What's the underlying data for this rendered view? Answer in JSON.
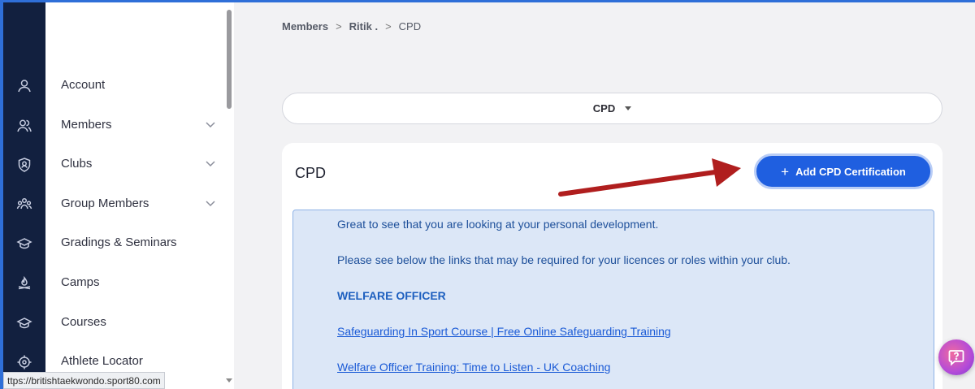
{
  "browser": {
    "status_url": "ttps://britishtaekwondo.sport80.com"
  },
  "rail_icons": [
    {
      "icon": "person-icon"
    },
    {
      "icon": "members-icon"
    },
    {
      "icon": "shield-icon"
    },
    {
      "icon": "group-icon"
    },
    {
      "icon": "graduation-cap-icon"
    },
    {
      "icon": "campfire-icon"
    },
    {
      "icon": "graduation-cap-icon"
    },
    {
      "icon": "locator-icon"
    }
  ],
  "sidebar": {
    "items": [
      {
        "label": "Account",
        "expandable": false
      },
      {
        "label": "Members",
        "expandable": true
      },
      {
        "label": "Clubs",
        "expandable": true
      },
      {
        "label": "Group Members",
        "expandable": true
      },
      {
        "label": "Gradings & Seminars",
        "expandable": false
      },
      {
        "label": "Camps",
        "expandable": false
      },
      {
        "label": "Courses",
        "expandable": false
      },
      {
        "label": "Athlete Locator",
        "expandable": false
      }
    ]
  },
  "breadcrumb": {
    "items": [
      "Members",
      "Ritik .",
      "CPD"
    ],
    "separator": ">"
  },
  "selector": {
    "value": "CPD"
  },
  "card": {
    "title": "CPD",
    "add_button_label": "Add CPD Certification",
    "add_button_icon": "plus-icon"
  },
  "info": {
    "intro": "Great to see that you are looking at your personal development.",
    "subtext": "Please see below the links that may be required for your licences or roles within your club.",
    "section_heading": "WELFARE OFFICER",
    "links": [
      "Safeguarding In Sport Course | Free Online Safeguarding Training",
      "Welfare Officer Training: Time to Listen - UK Coaching"
    ]
  },
  "colors": {
    "accent": "#1f5fe0",
    "rail_bg": "#12203f",
    "info_bg": "#dce7f7",
    "arrow": "#b01e1e"
  },
  "help": {
    "icon": "help-chat-icon"
  }
}
